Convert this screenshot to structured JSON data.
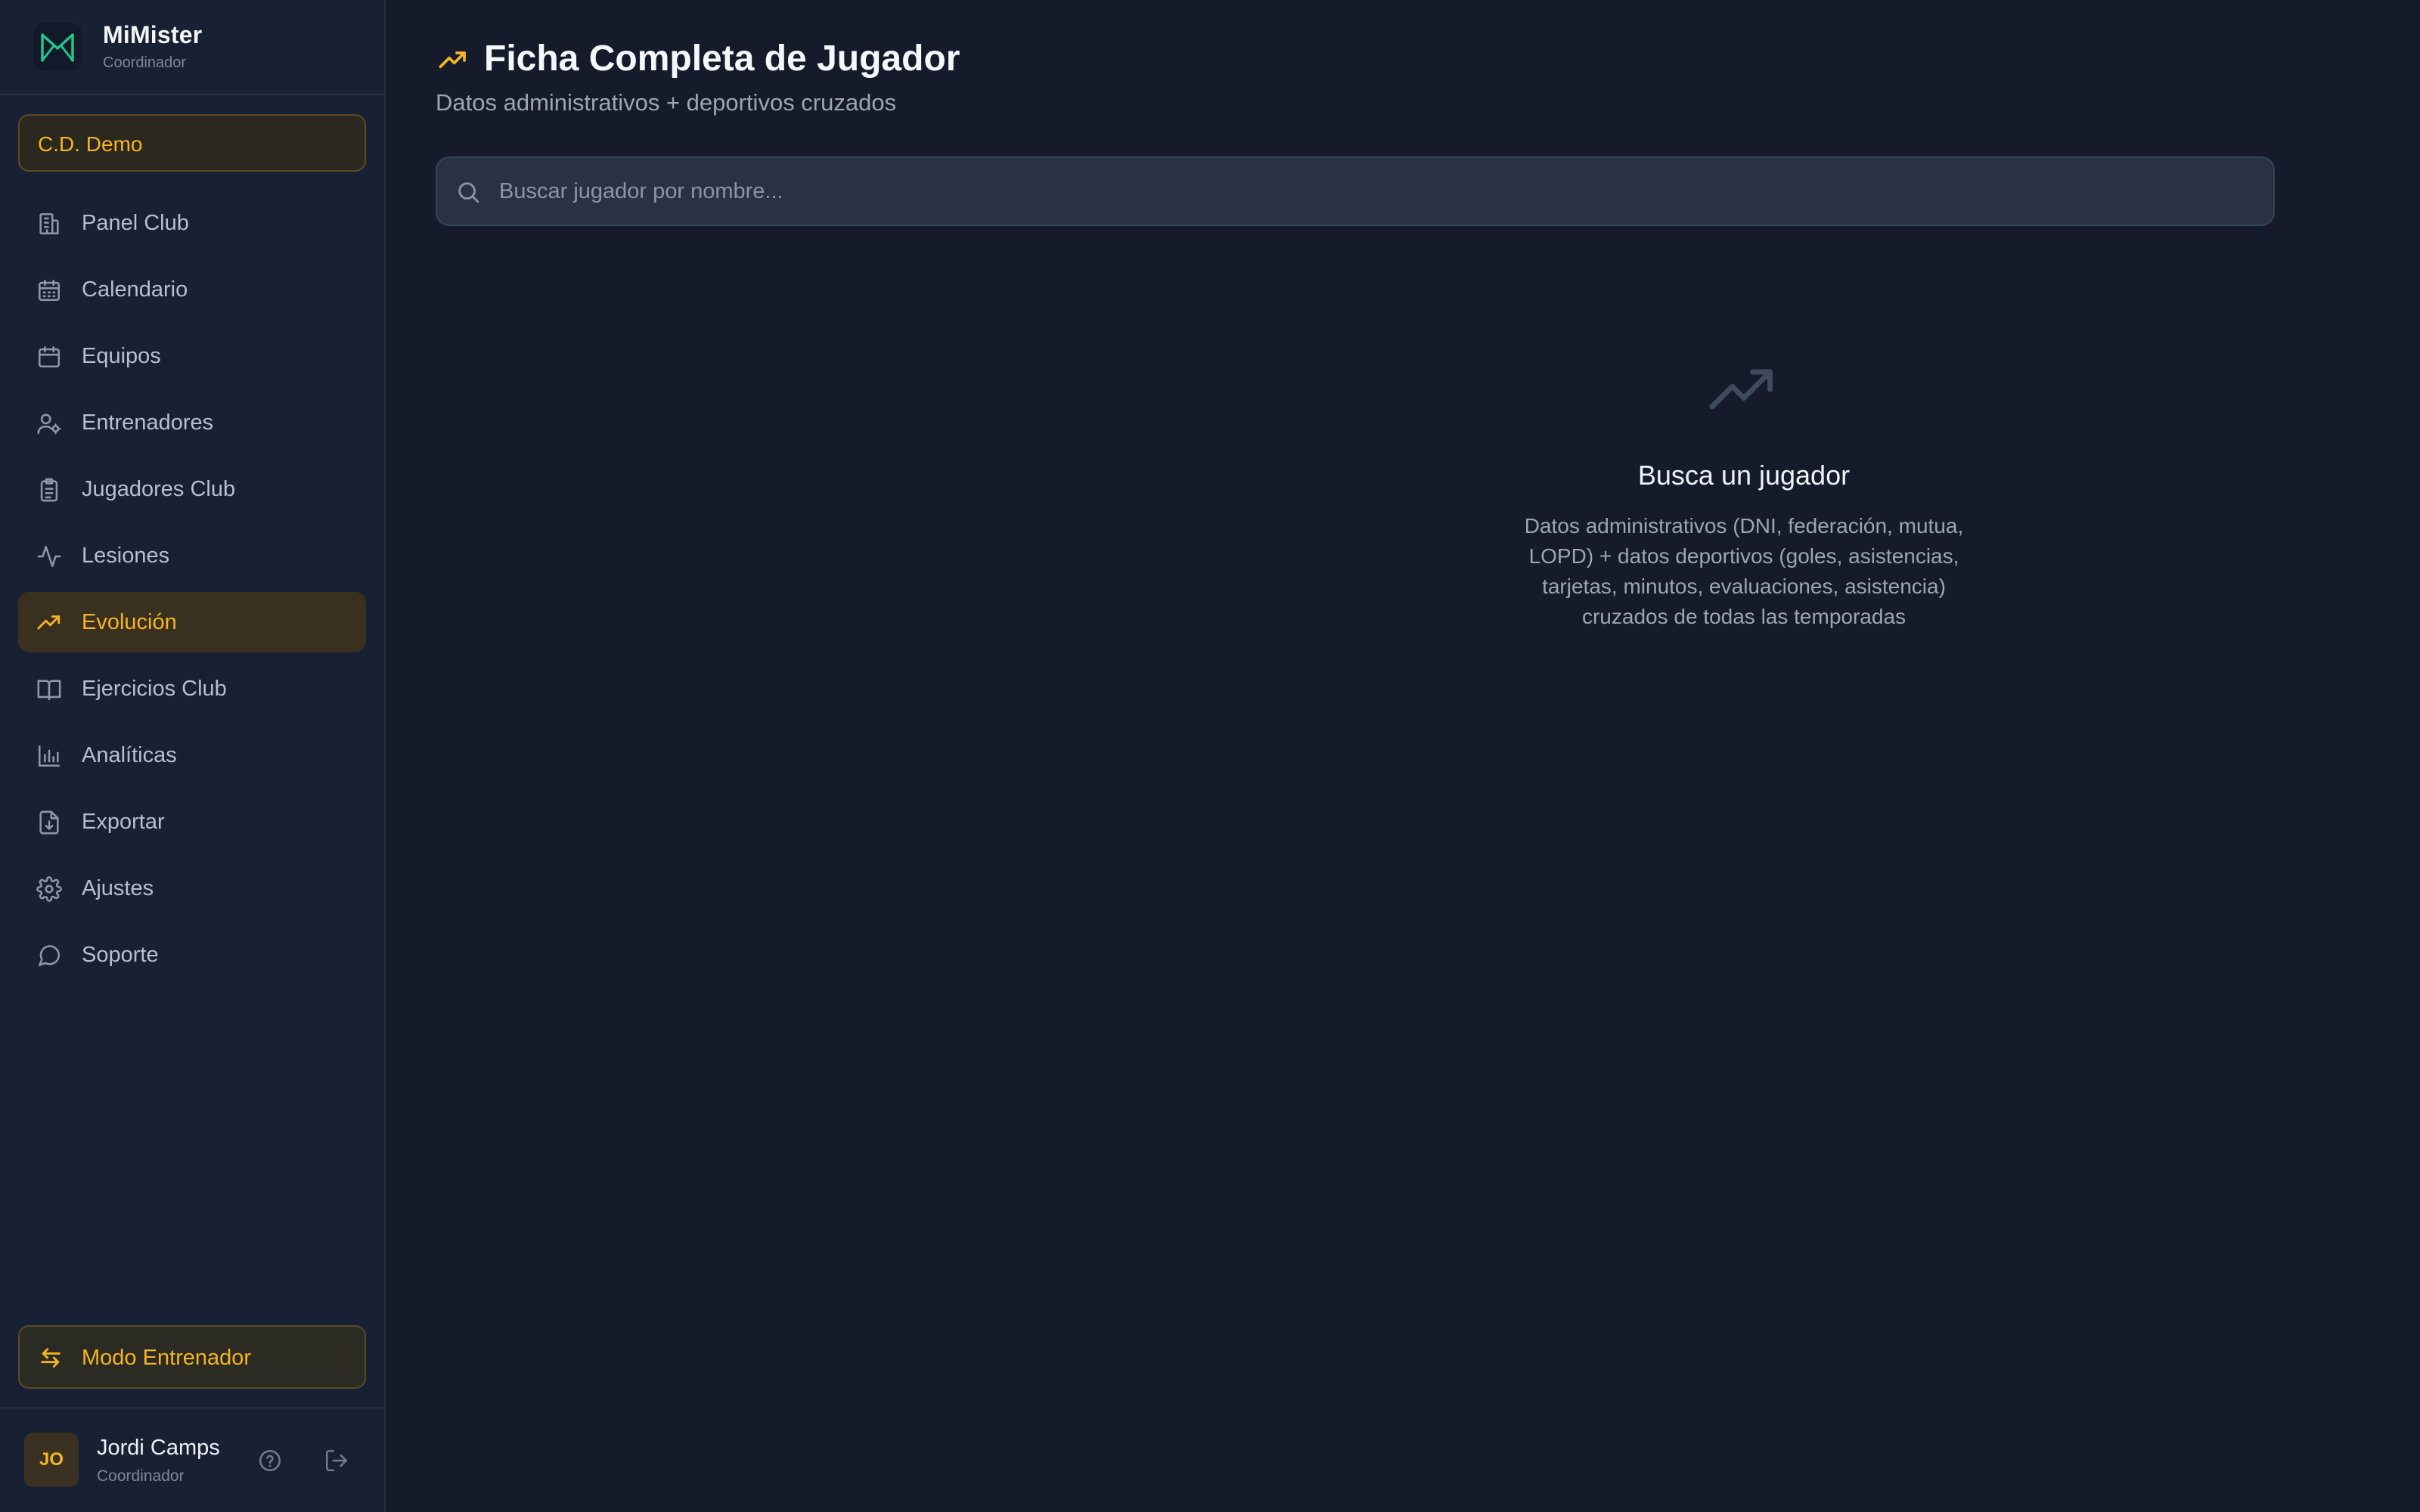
{
  "brand": {
    "name": "MiMister",
    "role": "Coordinador",
    "logo_icon": "mimister-logo-icon"
  },
  "club": {
    "name": "C.D. Demo"
  },
  "sidebar": {
    "items": [
      {
        "label": "Panel Club",
        "icon": "building-icon",
        "active": false
      },
      {
        "label": "Calendario",
        "icon": "calendar-grid-icon",
        "active": false
      },
      {
        "label": "Equipos",
        "icon": "calendar-icon",
        "active": false
      },
      {
        "label": "Entrenadores",
        "icon": "user-cog-icon",
        "active": false
      },
      {
        "label": "Jugadores Club",
        "icon": "clipboard-list-icon",
        "active": false
      },
      {
        "label": "Lesiones",
        "icon": "activity-icon",
        "active": false
      },
      {
        "label": "Evolución",
        "icon": "trending-up-icon",
        "active": true
      },
      {
        "label": "Ejercicios Club",
        "icon": "book-open-icon",
        "active": false
      },
      {
        "label": "Analíticas",
        "icon": "bar-chart-icon",
        "active": false
      },
      {
        "label": "Exportar",
        "icon": "file-download-icon",
        "active": false
      },
      {
        "label": "Ajustes",
        "icon": "settings-icon",
        "active": false
      },
      {
        "label": "Soporte",
        "icon": "message-circle-icon",
        "active": false
      }
    ],
    "mode_button": "Modo Entrenador"
  },
  "user": {
    "initials": "JO",
    "name": "Jordi Camps",
    "role": "Coordinador"
  },
  "page": {
    "title": "Ficha Completa de Jugador",
    "subtitle": "Datos administrativos + deportivos cruzados"
  },
  "search": {
    "placeholder": "Buscar jugador por nombre...",
    "value": ""
  },
  "empty_state": {
    "title": "Busca un jugador",
    "description": "Datos administrativos (DNI, federación, mutua, LOPD) + datos deportivos (goles, asistencias, tarjetas, minutos, evaluaciones, asistencia) cruzados de todas las temporadas"
  },
  "colors": {
    "background": "#151b2b",
    "sidebar": "#182134",
    "accent": "#f5b521",
    "brand_green": "#22c58b"
  }
}
